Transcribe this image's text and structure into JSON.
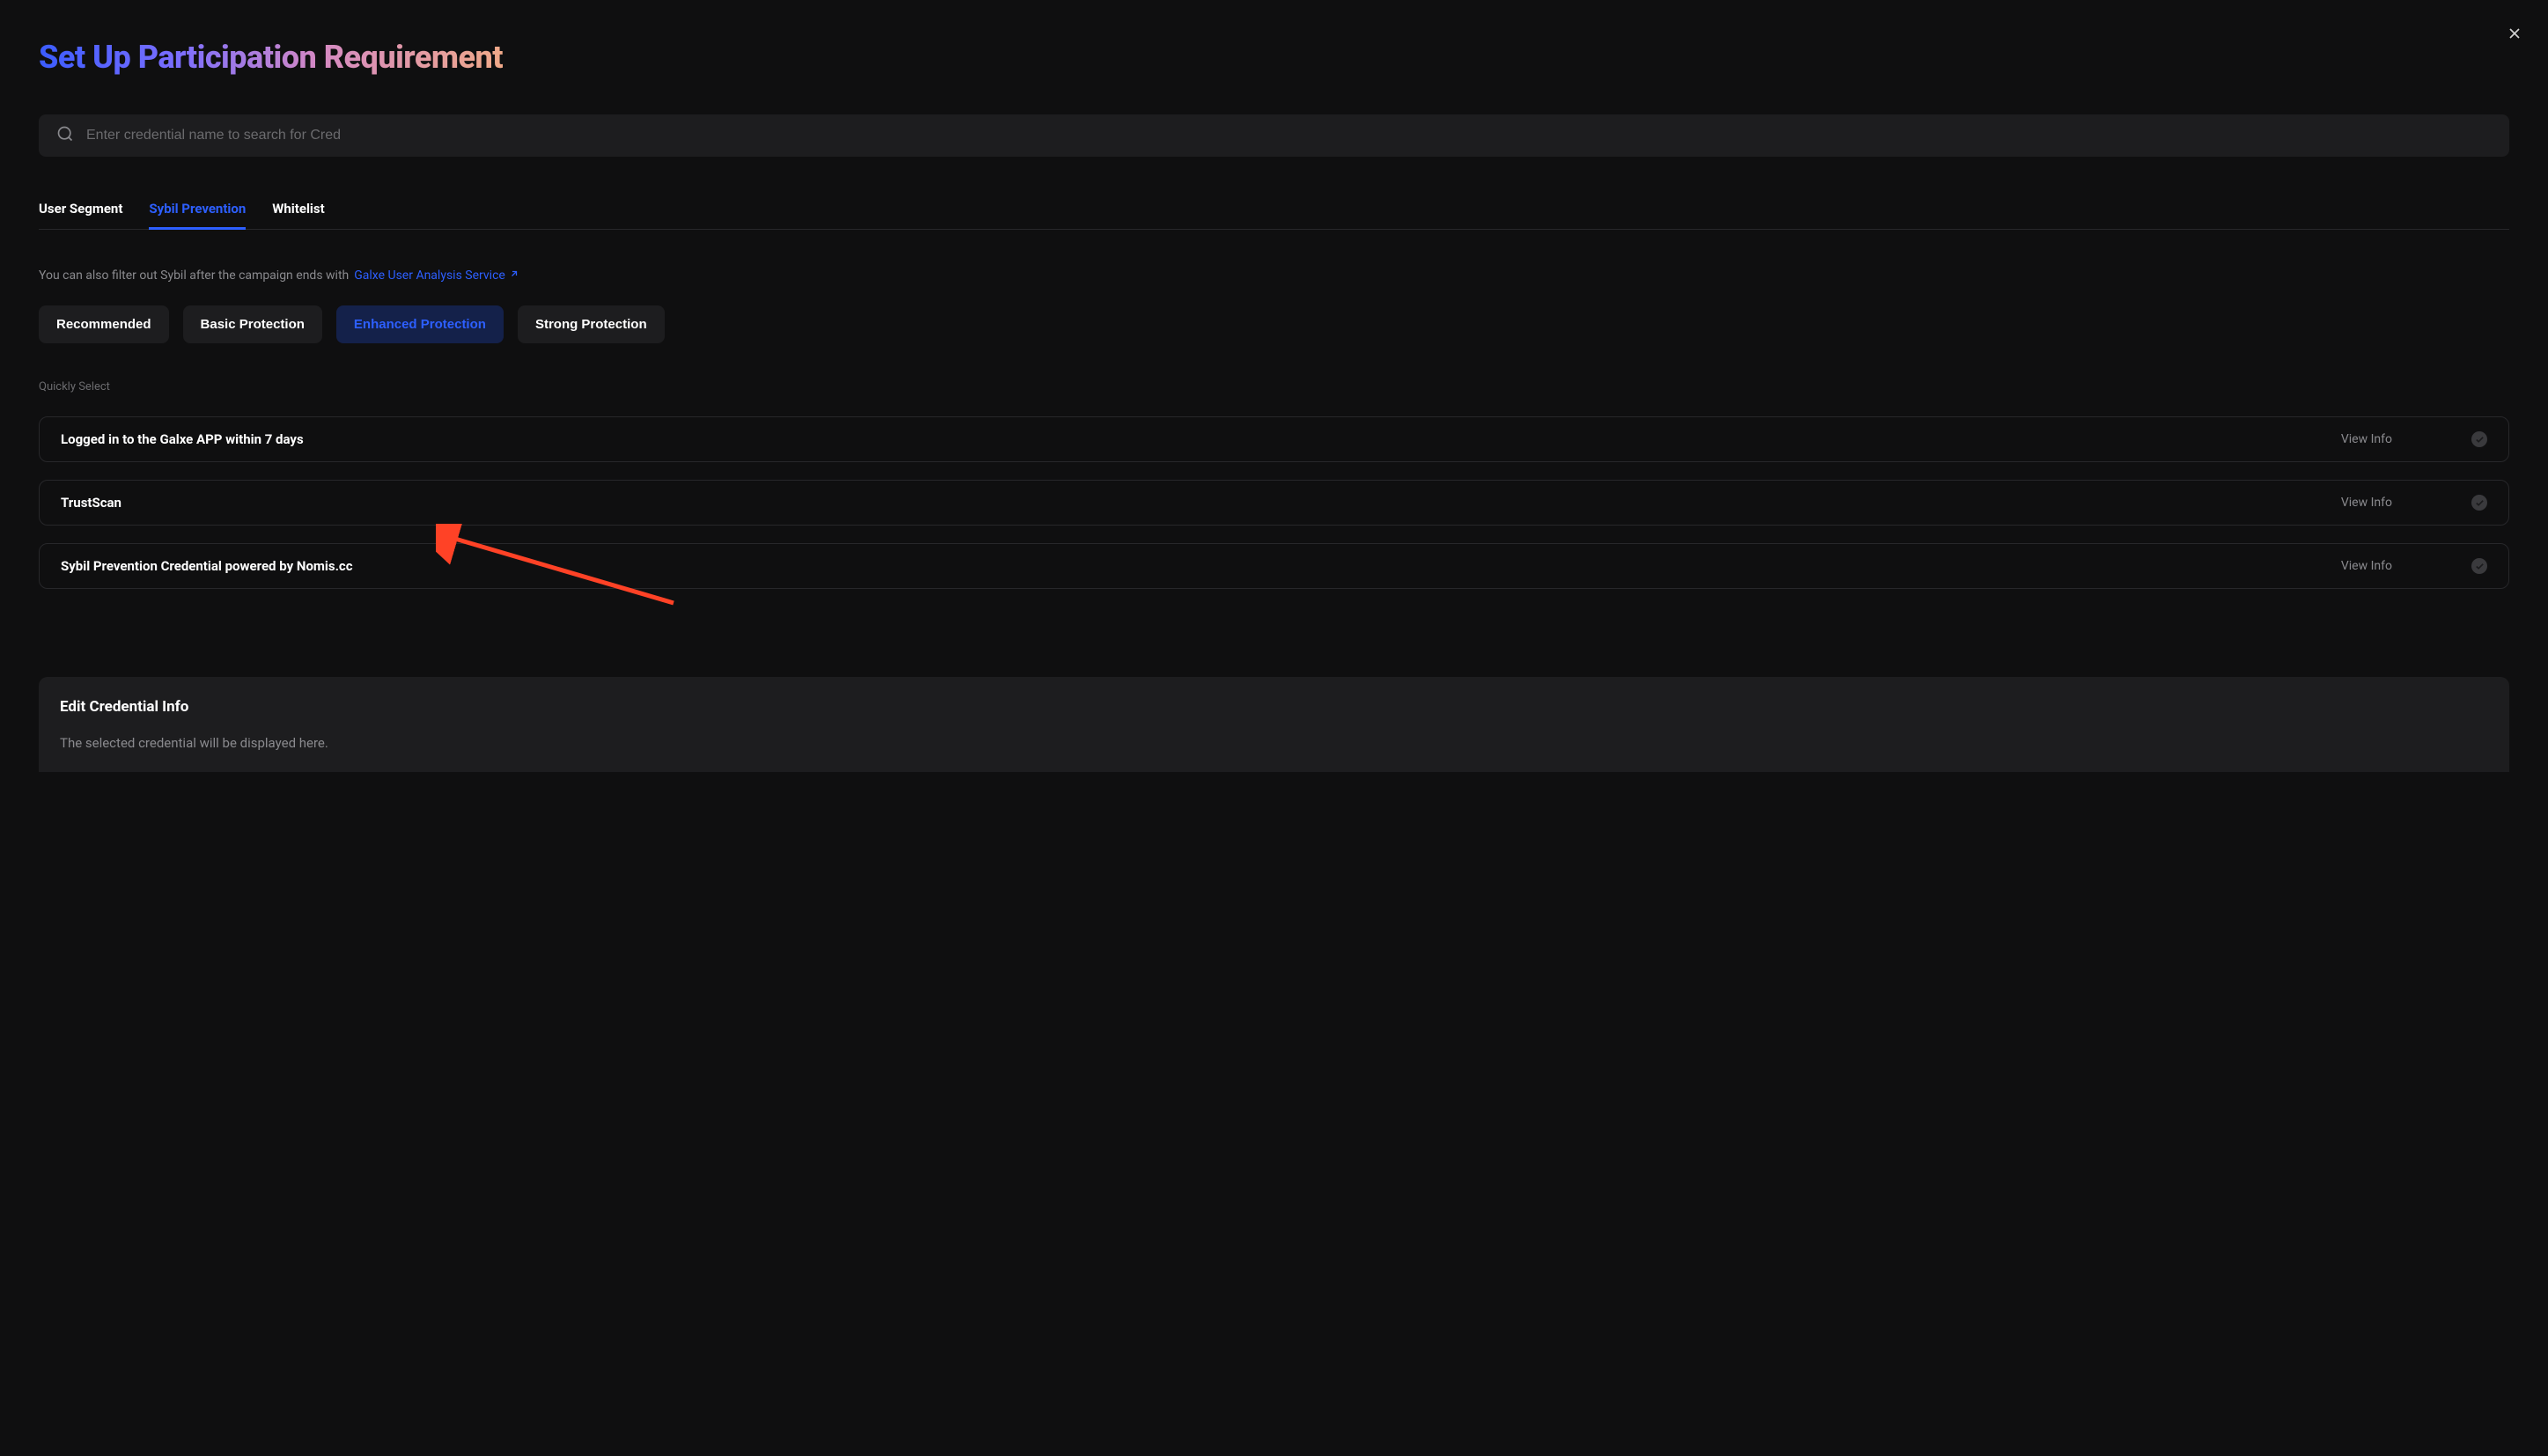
{
  "title": "Set Up Participation Requirement",
  "search": {
    "placeholder": "Enter credential name to search for Cred"
  },
  "tabs": {
    "items": [
      {
        "label": "User Segment",
        "active": false
      },
      {
        "label": "Sybil Prevention",
        "active": true
      },
      {
        "label": "Whitelist",
        "active": false
      }
    ]
  },
  "info": {
    "text": "You can also filter out Sybil after the campaign ends with",
    "link_label": "Galxe User Analysis Service"
  },
  "protection": {
    "buttons": [
      {
        "label": "Recommended",
        "active": false
      },
      {
        "label": "Basic Protection",
        "active": false
      },
      {
        "label": "Enhanced Protection",
        "active": true
      },
      {
        "label": "Strong Protection",
        "active": false
      }
    ]
  },
  "quickly_select_label": "Quickly Select",
  "credentials": [
    {
      "name": "Logged in to the Galxe APP within 7 days",
      "view_info": "View Info"
    },
    {
      "name": "TrustScan",
      "view_info": "View Info"
    },
    {
      "name": "Sybil Prevention Credential powered by Nomis.cc",
      "view_info": "View Info"
    }
  ],
  "edit_section": {
    "title": "Edit Credential Info",
    "description": "The selected credential will be displayed here."
  }
}
